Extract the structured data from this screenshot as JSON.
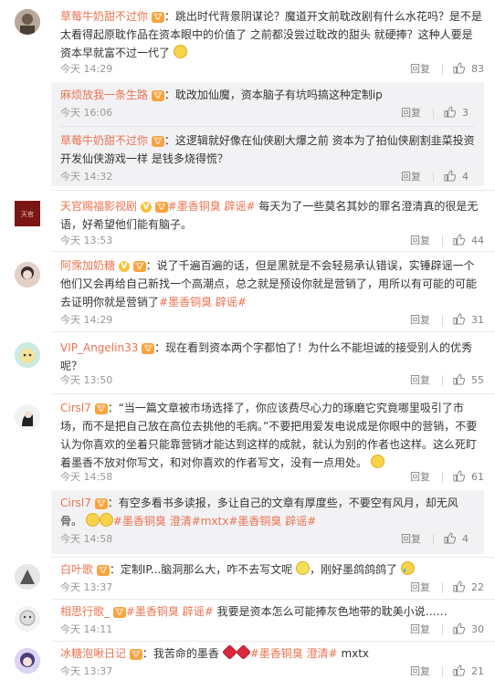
{
  "comments": [
    {
      "user": "草莓牛奶甜不过你",
      "text": "：跳出时代背景阴谋论？魔道开文前耽改剧有什么水花吗？是不是太看得起原耽作品在资本眼中的价值了 之前都没尝过耽改的甜头 就硬捧？这种人要是资本早就富不过一代了",
      "time": "今天 14:29",
      "reply": "回复",
      "likes": "83",
      "replies": [
        {
          "user": "麻烦放我一条生路",
          "text": "：耽改加仙魔，资本脑子有坑吗搞这种定制ip",
          "time": "今天 16:06",
          "reply": "回复",
          "likes": "3"
        },
        {
          "user": "草莓牛奶甜不过你",
          "text": "：这逻辑就好像在仙侠剧大爆之前 资本为了拍仙侠剧割韭菜投资开发仙侠游戏一样 是钱多烧得慌？",
          "time": "今天 14:32",
          "reply": "回复",
          "likes": "4"
        }
      ]
    },
    {
      "user": "天官赐福影视剧",
      "tags": "#墨香铜臭 辟谣#",
      "text": " 每天为了一些莫名其妙的罪名澄清真的很是无语，好希望他们能有脑子。",
      "time": "今天 13:53",
      "reply": "回复",
      "likes": "44"
    },
    {
      "user": "阿霈加奶糖",
      "text": "：说了千遍百遍的话，但是黑就是不会轻易承认错误，实锤辟谣一个他们又会再给自己新找一个高潮点，总之就是预设你就是营销了，用所以有可能的可能去证明你就是营销了",
      "tags": "#墨香铜臭 辟谣#",
      "time": "今天 14:29",
      "reply": "回复",
      "likes": "31"
    },
    {
      "user": "VIP_Angelin33",
      "text": "：现在看到资本两个字都怕了！为什么不能坦诚的接受别人的优秀呢？",
      "time": "今天 13:50",
      "reply": "回复",
      "likes": "55"
    },
    {
      "user": "Cirsl7",
      "text": "：“当一篇文章被市场选择了，你应该费尽心力的琢磨它究竟哪里吸引了市场，而不是把自己放在高位去挑他的毛病。”不要把用爱发电说成是你眼中的营销，不要认为你喜欢的坐着只能靠营销才能达到这样的成就，就认为别的作者也这样。这么死盯着墨香不放对你写文，和对你喜欢的作者写文，没有一点用处。",
      "time": "今天 14:58",
      "reply": "回复",
      "likes": "61",
      "replies": [
        {
          "user": "Cirsl7",
          "text": "：有空多看书多读报，多让自己的文章有厚度些，不要空有风月，却无风骨。",
          "tags": "#墨香铜臭 澄清#mxtx#墨香铜臭 辟谣#",
          "time": "今天 14:58",
          "reply": "回复",
          "likes": "4"
        }
      ]
    },
    {
      "user": "白叶歌",
      "text": "：定制IP...脑洞那么大，咋不去写文呢",
      "text2": "，刚好墨鸽鸽鸽了",
      "time": "今天 13:37",
      "reply": "回复",
      "likes": "22"
    },
    {
      "user": "相思行歌_",
      "tags": "#墨香铜臭 辟谣#",
      "text": " 我要是资本怎么可能捧灰色地带的耽美小说……",
      "time": "今天 14:11",
      "reply": "回复",
      "likes": "30"
    },
    {
      "user": "冰糖泡啾日记",
      "text": "：我苦命的墨香",
      "tags": "#墨香铜臭 澄清#",
      "text2": " mxtx",
      "time": "今天 13:37",
      "reply": "回复",
      "likes": "21"
    }
  ],
  "colors": {
    "username": "#eb7350",
    "text": "#333333",
    "meta": "#999999",
    "subbox": "#f2f2f5"
  }
}
